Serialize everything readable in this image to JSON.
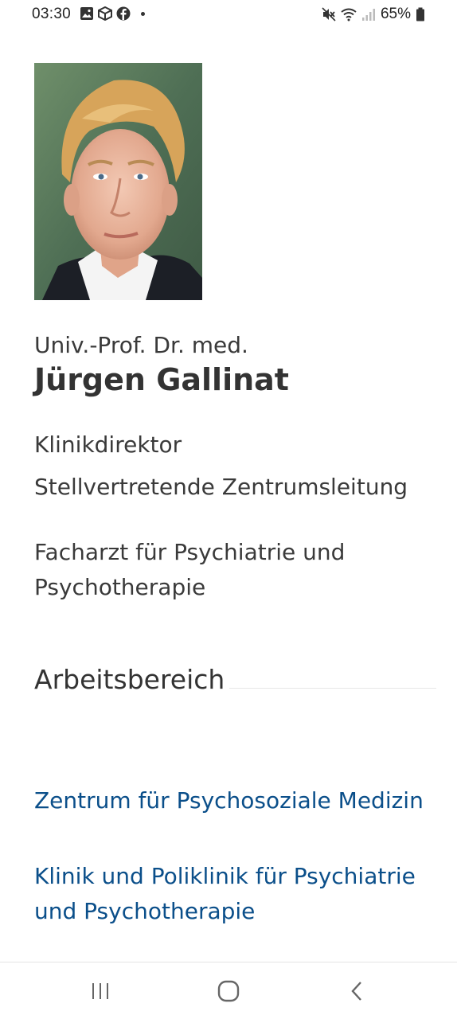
{
  "status_bar": {
    "time": "03:30",
    "battery": "65%"
  },
  "profile": {
    "photo_alt": "Portrait",
    "title_prefix": "Univ.-Prof. Dr. med.",
    "name": "Jürgen Gallinat",
    "roles": [
      "Klinikdirektor",
      "Stellvertretende Zentrumsleitung"
    ],
    "specialty": "Facharzt für Psychiatrie und Psychotherapie"
  },
  "section": {
    "heading": "Arbeitsbereich"
  },
  "links": [
    {
      "label": "Zentrum für Psychosoziale Medizin"
    },
    {
      "label": "Klinik und Poliklinik für Psychiatrie und Psychotherapie"
    }
  ],
  "colors": {
    "link": "#0b4f8a",
    "text": "#333333"
  }
}
